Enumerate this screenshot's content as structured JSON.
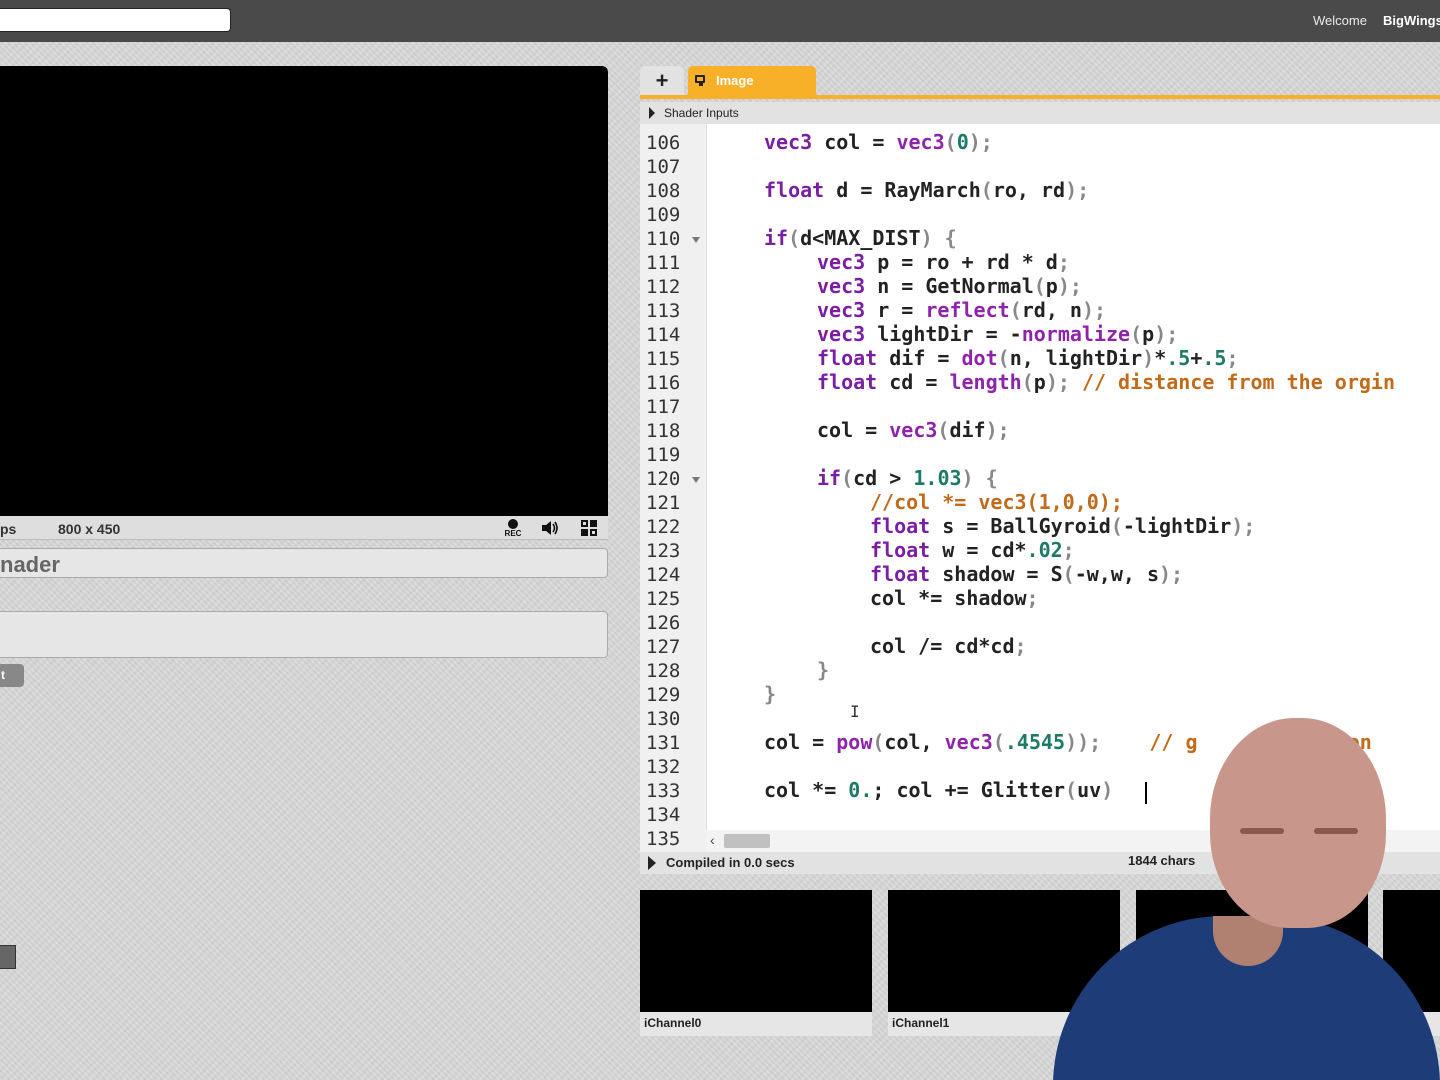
{
  "header": {
    "search": {
      "value": "",
      "placeholder": ""
    },
    "welcome": "Welcome",
    "username": "BigWings"
  },
  "viewer": {
    "fps": "ps",
    "resolution": "800 x 450",
    "rec_label": "REC",
    "icons": [
      "record-icon",
      "volume-icon",
      "fullscreen-icon"
    ]
  },
  "shader_info": {
    "title": "nader",
    "description": "",
    "button_label": "t"
  },
  "editor": {
    "tabs": [
      {
        "label": "+",
        "icon": "plus-icon"
      },
      {
        "label": "Image",
        "icon": "monitor-icon",
        "active": true
      }
    ],
    "shader_inputs_label": "Shader Inputs",
    "lines": [
      {
        "n": "106"
      },
      {
        "n": "107"
      },
      {
        "n": "108"
      },
      {
        "n": "109"
      },
      {
        "n": "110"
      },
      {
        "n": "111"
      },
      {
        "n": "112"
      },
      {
        "n": "113"
      },
      {
        "n": "114"
      },
      {
        "n": "115"
      },
      {
        "n": "116"
      },
      {
        "n": "117"
      },
      {
        "n": "118"
      },
      {
        "n": "119"
      },
      {
        "n": "120"
      },
      {
        "n": "121"
      },
      {
        "n": "122"
      },
      {
        "n": "123"
      },
      {
        "n": "124"
      },
      {
        "n": "125"
      },
      {
        "n": "126"
      },
      {
        "n": "127"
      },
      {
        "n": "128"
      },
      {
        "n": "129"
      },
      {
        "n": "130"
      },
      {
        "n": "131"
      },
      {
        "n": "132"
      },
      {
        "n": "133"
      },
      {
        "n": "134"
      },
      {
        "n": "135"
      }
    ],
    "code": {
      "l106": {
        "a": "vec3",
        "b": " col = ",
        "c": "vec3",
        "d": "(",
        "e": "0",
        "f": ");"
      },
      "l108": {
        "a": "float",
        "b": " d = RayMarch",
        "c": "(",
        "d": "ro, rd",
        "e": ");"
      },
      "l110": {
        "a": "if",
        "b": "(",
        "c": "d<MAX_DIST",
        "d": ") {"
      },
      "l111": {
        "a": "vec3",
        "b": " p = ro + rd * d",
        "c": ";"
      },
      "l112": {
        "a": "vec3",
        "b": " n = GetNormal",
        "c": "(",
        "d": "p",
        "e": ");"
      },
      "l113": {
        "a": "vec3",
        "b": " r = ",
        "c": "reflect",
        "d": "(",
        "e": "rd, n",
        "f": ");"
      },
      "l114": {
        "a": "vec3",
        "b": " lightDir = -",
        "c": "normalize",
        "d": "(",
        "e": "p",
        "f": ");"
      },
      "l115": {
        "a": "float",
        "b": " dif = ",
        "c": "dot",
        "d": "(",
        "e": "n, lightDir",
        "f": ")",
        "g": "*",
        "h": ".5",
        "i": "+",
        "j": ".5",
        "k": ";"
      },
      "l116": {
        "a": "float",
        "b": " cd = ",
        "c": "length",
        "d": "(",
        "e": "p",
        "f": "); ",
        "g": "// distance from the orgin"
      },
      "l118": {
        "a": "col = ",
        "b": "vec3",
        "c": "(",
        "d": "dif",
        "e": ");"
      },
      "l120": {
        "a": "if",
        "b": "(",
        "c": "cd > ",
        "d": "1.03",
        "e": ") {"
      },
      "l121": {
        "a": "//col *= vec3(1,0,0);"
      },
      "l122": {
        "a": "float",
        "b": " s = BallGyroid",
        "c": "(",
        "d": "-lightDir",
        "e": ");"
      },
      "l123": {
        "a": "float",
        "b": " w = cd*",
        "c": ".02",
        "d": ";"
      },
      "l124": {
        "a": "float",
        "b": " shadow = S",
        "c": "(",
        "d": "-w,w, s",
        "e": ");"
      },
      "l125": {
        "a": "col *= shadow",
        "b": ";"
      },
      "l127": {
        "a": "col /= cd*cd",
        "b": ";"
      },
      "l128": {
        "a": "}"
      },
      "l129": {
        "a": "}"
      },
      "l131": {
        "a": "col = ",
        "b": "pow",
        "c": "(",
        "d": "col, ",
        "e": "vec3",
        "f": "(",
        "g": ".4545",
        "h": "));    ",
        "i": "// g",
        "j": "rection"
      },
      "l133": {
        "a": "col *= ",
        "b": "0.",
        "c": "; col += Glitter",
        "d": "(",
        "e": "uv",
        "f": ")"
      }
    },
    "status": {
      "compiled": "Compiled in 0.0 secs",
      "chars": "1844 chars"
    }
  },
  "channels": [
    {
      "label": "iChannel0"
    },
    {
      "label": "iChannel1"
    },
    {
      "label": ""
    },
    {
      "label": ""
    }
  ],
  "colors": {
    "accent": "#f7b028",
    "topbar": "#4a4a4a",
    "keyword": "#7b1fa2",
    "number": "#1b7b66",
    "comment": "#c06a1a"
  }
}
